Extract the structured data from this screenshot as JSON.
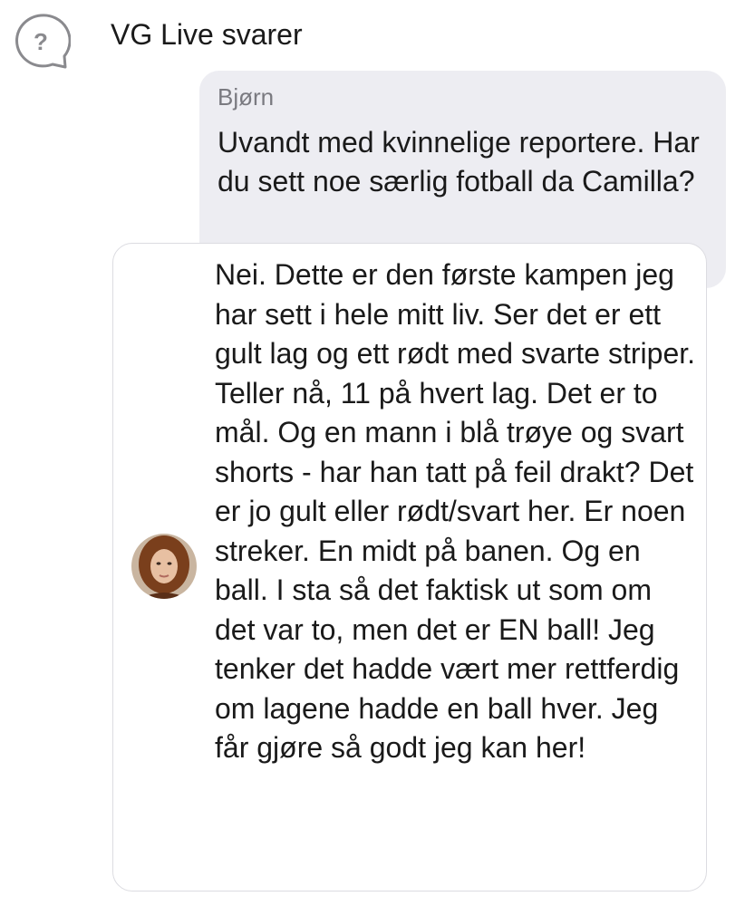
{
  "header": {
    "title": "VG Live svarer",
    "icon": "question-bubble-icon"
  },
  "question": {
    "author": "Bjørn",
    "text": "Uvandt med kvinnelige reportere. Har du sett noe særlig fotball da Camilla?"
  },
  "answer": {
    "avatar": "reporter-avatar",
    "text": "Nei. Dette er den første kampen jeg har sett i hele mitt liv. Ser det er ett gult lag og ett rødt med svarte striper. Teller nå, 11 på hvert lag. Det er to mål. Og en mann i blå trøye og svart shorts - har han tatt på feil drakt? Det er jo gult eller rødt/svart her. Er noen streker. En midt på banen. Og en ball. I sta så det faktisk ut som om det var to, men det er EN ball! Jeg tenker det hadde vært mer rettferdig om lagene hadde en ball hver. Jeg får gjøre så godt jeg kan her!"
  },
  "colors": {
    "question_bg": "#ededf2",
    "card_border": "#dcdce1",
    "author_gray": "#7a7a80"
  }
}
